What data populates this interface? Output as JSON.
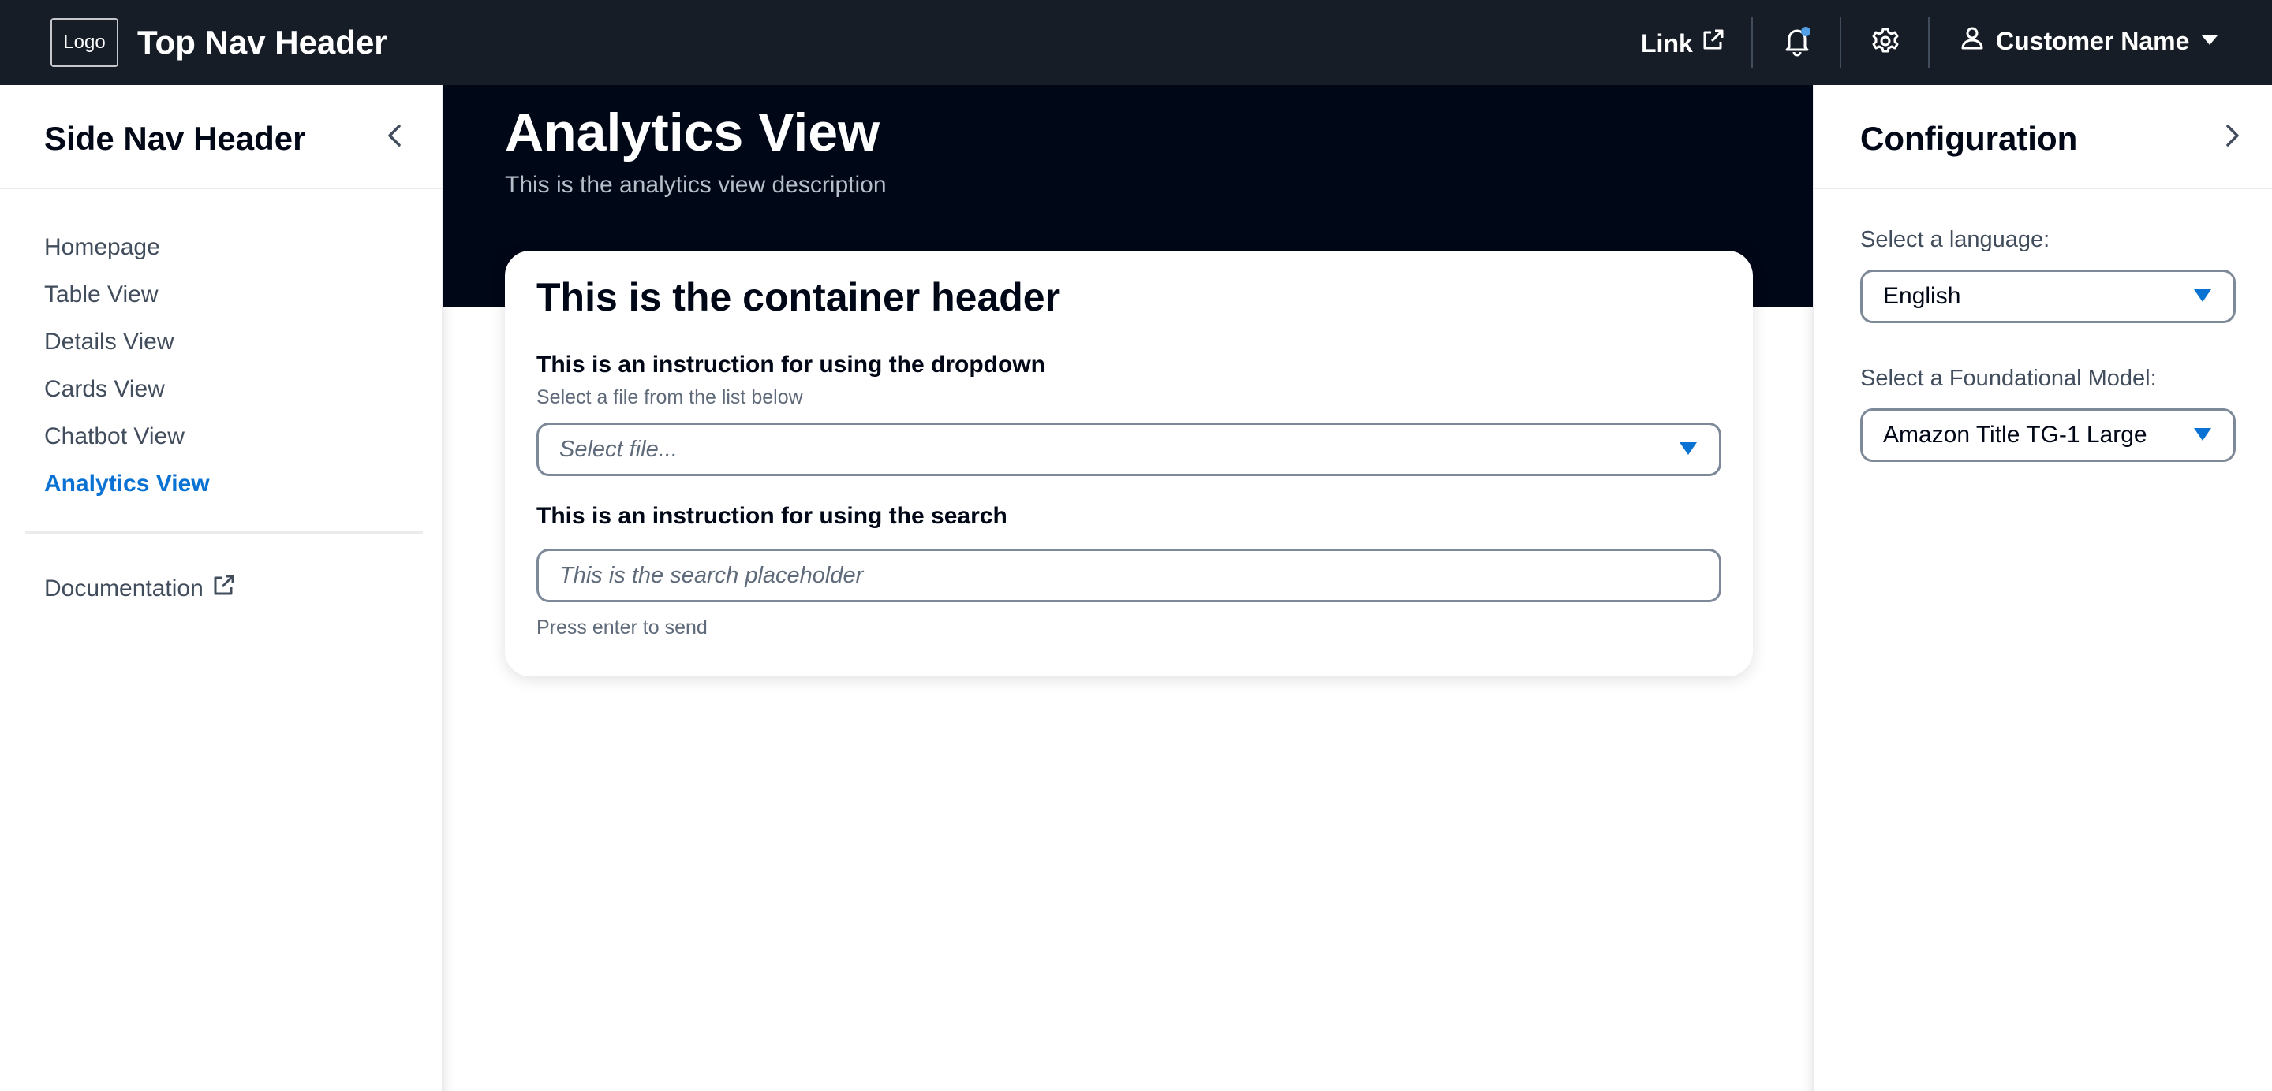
{
  "topnav": {
    "logo": "Logo",
    "title": "Top Nav Header",
    "link_label": "Link",
    "user_name": "Customer Name",
    "notification_dot_color": "#539fe5"
  },
  "sidenav": {
    "header": "Side Nav Header",
    "items": [
      {
        "label": "Homepage"
      },
      {
        "label": "Table View"
      },
      {
        "label": "Details View"
      },
      {
        "label": "Cards View"
      },
      {
        "label": "Chatbot View"
      },
      {
        "label": "Analytics View",
        "active": true
      }
    ],
    "documentation": "Documentation"
  },
  "main": {
    "title": "Analytics View",
    "description": "This is the analytics view description",
    "container": {
      "header": "This is the container header",
      "dropdown_instruction": "This is an instruction for using the dropdown",
      "dropdown_description": "Select a file from the list below",
      "dropdown_placeholder": "Select file...",
      "search_instruction": "This is an instruction for using the search",
      "search_placeholder": "This is the search placeholder",
      "search_hint": "Press enter to send"
    }
  },
  "config": {
    "header": "Configuration",
    "language_label": "Select a language:",
    "language_value": "English",
    "model_label": "Select a Foundational Model:",
    "model_value": "Amazon Title TG-1 Large"
  },
  "colors": {
    "accent": "#0972d3",
    "topnav_bg": "#161d26",
    "hero_bg": "#000716"
  }
}
